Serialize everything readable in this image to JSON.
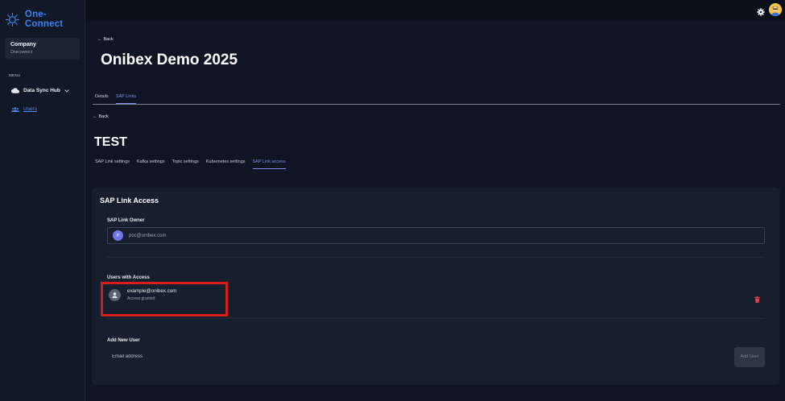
{
  "app": {
    "name": "One-Connect"
  },
  "sidebar": {
    "company": {
      "title": "Company",
      "subtitle": "Oneconnect"
    },
    "menu_label": "MENU",
    "items": [
      {
        "label": "Data Sync Hub",
        "icon": "cloud-icon"
      },
      {
        "label": "Users",
        "icon": "users-icon"
      }
    ]
  },
  "topbar": {
    "settings_icon": "gear-icon",
    "avatar_icon": "user-avatar"
  },
  "header": {
    "back_label": "Back",
    "title": "Onibex Demo 2025",
    "tabs": [
      {
        "label": "Details",
        "active": false
      },
      {
        "label": "SAP Links",
        "active": true
      }
    ]
  },
  "sap_link": {
    "back_label": "Back",
    "title": "TEST",
    "tabs": [
      {
        "label": "SAP Link settings",
        "active": false
      },
      {
        "label": "Kafka settings",
        "active": false
      },
      {
        "label": "Topic settings",
        "active": false
      },
      {
        "label": "Kubernetes settings",
        "active": false
      },
      {
        "label": "SAP Link access",
        "active": true
      }
    ]
  },
  "access_panel": {
    "title": "SAP Link Access",
    "owner_label": "SAP Link Owner",
    "owner": {
      "initial": "P",
      "email": "poc@onibex.com"
    },
    "users_label": "Users with Access",
    "users": [
      {
        "email": "example@onibex.com",
        "status": "Access granted"
      }
    ],
    "add_label": "Add New User",
    "email_placeholder": "Email address",
    "add_button": "Add User"
  },
  "colors": {
    "accent": "#7c93f0",
    "link": "#4f8df7",
    "highlight": "#d91c1c",
    "danger": "#d9434f"
  }
}
